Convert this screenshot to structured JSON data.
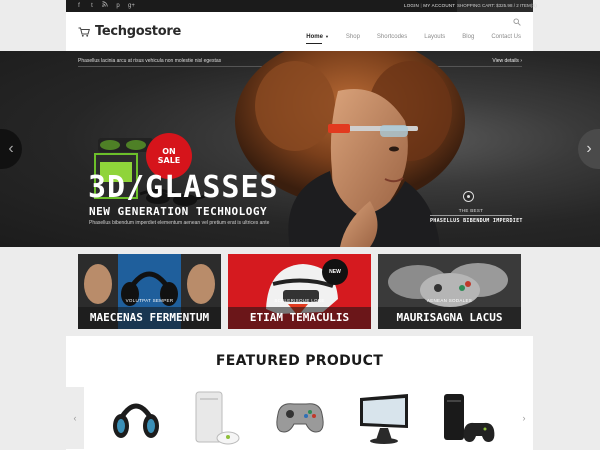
{
  "topbar": {
    "social": [
      "f",
      "t",
      "rss",
      "p",
      "g+"
    ],
    "login": "LOGIN",
    "separator": "|",
    "my_account": "MY ACCOUNT",
    "cart": "SHOPPING CART: $325.98 / 2 ITEM(S)"
  },
  "header": {
    "logo": "Techgostore",
    "nav": [
      "Home",
      "Shop",
      "Shortcodes",
      "Layouts",
      "Blog",
      "Contact Us"
    ]
  },
  "hero": {
    "ticker_text": "Phasellus lacinia arcu at risus vehicula non molestie nisl egestas",
    "view_details": "View details ›",
    "badge_line1": "ON",
    "badge_line2": "SALE",
    "title": "3D/GLASSES",
    "subtitle": "NEW GENERATION TECHNOLOGY",
    "caption": "Phasellus bibendum imperdiet elementum aenean vel pretium erat is ultrices ante",
    "best_small": "THE BEST",
    "best_phrase": "PHASELLUS BIBENDUM IMPERDIET",
    "prev": "‹",
    "next": "›"
  },
  "promos": [
    {
      "small": "VOLUTPAT SEMPER",
      "label": "MAECENAS FERMENTUM"
    },
    {
      "small": "SCELERISQUE LORE",
      "label": "ETIAM TEMACULIS",
      "badge": "NEW"
    },
    {
      "small": "AENEAN SODALES",
      "label": "MAURISAGNA LACUS"
    }
  ],
  "featured": {
    "title": "FEATURED PRODUCT",
    "prev": "‹",
    "next": "›",
    "products": [
      "headphones",
      "console",
      "controller",
      "monitor",
      "console-black"
    ]
  }
}
